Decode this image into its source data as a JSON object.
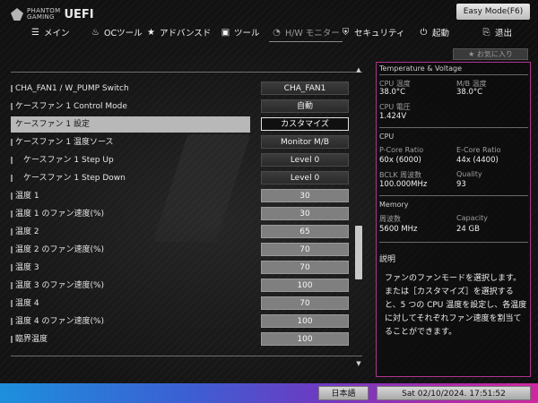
{
  "header": {
    "logo_text_1": "PHANTOM",
    "logo_text_2": "GAMING",
    "logo_uefi": "UEFI",
    "easy_mode": "Easy Mode(F6)"
  },
  "nav": [
    {
      "label": "メイン",
      "icon": "list-icon"
    },
    {
      "label": "OCツール",
      "icon": "flame-icon"
    },
    {
      "label": "アドバンスド",
      "icon": "star-icon"
    },
    {
      "label": "ツール",
      "icon": "briefcase-icon"
    },
    {
      "label": "H/W モニター",
      "icon": "gauge-icon",
      "active": true
    },
    {
      "label": "セキュリティ",
      "icon": "shield-icon"
    },
    {
      "label": "起動",
      "icon": "power-icon"
    },
    {
      "label": "退出",
      "icon": "exit-icon"
    }
  ],
  "favorite": {
    "label": "お気に入り"
  },
  "settings": [
    {
      "label": "CHA_FAN1 / W_PUMP Switch",
      "value": "CHA_FAN1",
      "style": "option"
    },
    {
      "label": "ケースファン 1 Control Mode",
      "value": "自動",
      "style": "option"
    },
    {
      "label": "ケースファン 1 設定",
      "value": "カスタマイズ",
      "style": "active-sel",
      "selected": true
    },
    {
      "label": "ケースファン 1 温度ソース",
      "value": "Monitor M/B",
      "style": "option"
    },
    {
      "label": "ケースファン 1 Step Up",
      "value": "Level 0",
      "style": "option",
      "indent": true
    },
    {
      "label": "ケースファン 1 Step Down",
      "value": "Level 0",
      "style": "option",
      "indent": true
    },
    {
      "label": "温度 1",
      "value": "30",
      "style": "num"
    },
    {
      "label": "温度 1 のファン速度(%)",
      "value": "30",
      "style": "num"
    },
    {
      "label": "温度 2",
      "value": "65",
      "style": "num"
    },
    {
      "label": "温度 2 のファン速度(%)",
      "value": "70",
      "style": "num"
    },
    {
      "label": "温度 3",
      "value": "70",
      "style": "num"
    },
    {
      "label": "温度 3 のファン速度(%)",
      "value": "100",
      "style": "num"
    },
    {
      "label": "温度 4",
      "value": "70",
      "style": "num"
    },
    {
      "label": "温度 4 のファン速度(%)",
      "value": "100",
      "style": "num"
    },
    {
      "label": "臨界温度",
      "value": "100",
      "style": "num"
    }
  ],
  "monitor": {
    "tv_title": "Temperature & Voltage",
    "cpu_temp_label": "CPU 温度",
    "cpu_temp": "38.0°C",
    "mb_temp_label": "M/B 温度",
    "mb_temp": "38.0°C",
    "cpu_volt_label": "CPU 電圧",
    "cpu_volt": "1.424V",
    "cpu_title": "CPU",
    "pcore_label": "P-Core Ratio",
    "pcore": "60x (6000)",
    "ecore_label": "E-Core Ratio",
    "ecore": "44x (4400)",
    "bclk_label": "BCLK 周波数",
    "bclk": "100.000MHz",
    "quality_label": "Quality",
    "quality": "93",
    "mem_title": "Memory",
    "freq_label": "周波数",
    "freq": "5600 MHz",
    "cap_label": "Capacity",
    "cap": "24 GB"
  },
  "description": {
    "title": "説明",
    "text": "ファンのファンモードを選択します。または［カスタマイズ］を選択すると、5 つの CPU 温度を設定し、各温度に対してそれぞれファン速度を割当てることができます。"
  },
  "footer": {
    "language": "日本語",
    "datetime": "Sat 02/10/2024. 17:51:52"
  },
  "colors": {
    "accent_magenta": "#b0348f",
    "bottom_gradient_start": "#1d8fdc",
    "bottom_gradient_end": "#d0279f"
  }
}
